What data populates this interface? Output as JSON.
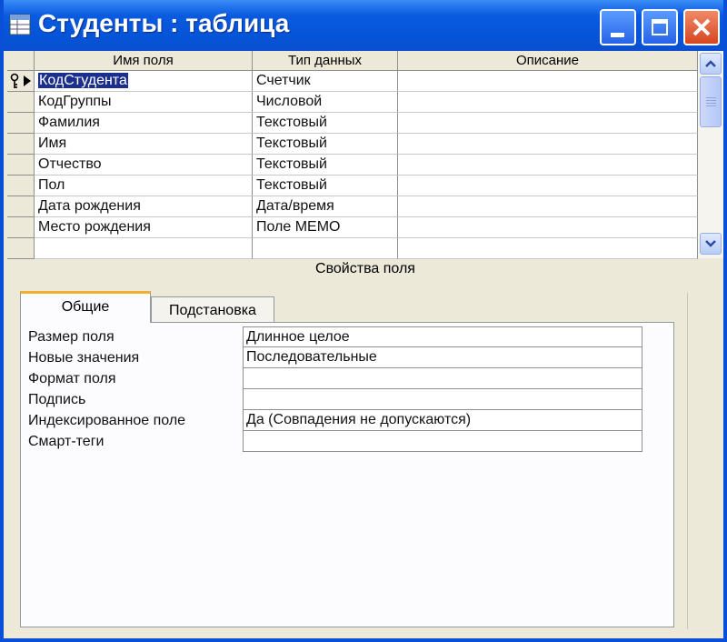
{
  "window": {
    "title": "Студенты : таблица"
  },
  "grid": {
    "headers": [
      "Имя поля",
      "Тип данных",
      "Описание"
    ],
    "rows": [
      {
        "name": "КодСтудента",
        "type": "Счетчик",
        "description": "",
        "key": true
      },
      {
        "name": "КодГруппы",
        "type": "Числовой",
        "description": ""
      },
      {
        "name": "Фамилия",
        "type": "Текстовый",
        "description": ""
      },
      {
        "name": "Имя",
        "type": "Текстовый",
        "description": ""
      },
      {
        "name": "Отчество",
        "type": "Текстовый",
        "description": ""
      },
      {
        "name": "Пол",
        "type": "Текстовый",
        "description": ""
      },
      {
        "name": "Дата рождения",
        "type": "Дата/время",
        "description": ""
      },
      {
        "name": "Место рождения",
        "type": "Поле MEMO",
        "description": ""
      }
    ]
  },
  "properties": {
    "title": "Свойства поля",
    "tabs": [
      "Общие",
      "Подстановка"
    ],
    "active_tab": "Общие",
    "rows": [
      {
        "label": "Размер поля",
        "value": "Длинное целое"
      },
      {
        "label": "Новые значения",
        "value": "Последовательные"
      },
      {
        "label": "Формат поля",
        "value": ""
      },
      {
        "label": "Подпись",
        "value": ""
      },
      {
        "label": "Индексированное поле",
        "value": "Да (Совпадения не допускаются)"
      },
      {
        "label": "Смарт-теги",
        "value": ""
      }
    ]
  },
  "colors": {
    "titlebar": "#0a5be0",
    "selection": "#1b2f8c",
    "close_button": "#d6461f",
    "tab_highlight": "#f0b030"
  },
  "icons": {
    "primary_key": "key-icon",
    "row_selector": "triangle-right-icon"
  }
}
